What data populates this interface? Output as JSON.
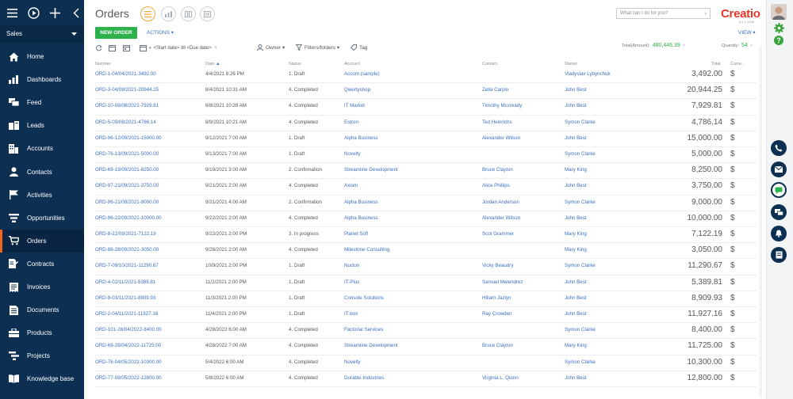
{
  "sidebar": {
    "section": "Sales",
    "items": [
      {
        "label": "Home",
        "icon": "home-icon"
      },
      {
        "label": "Dashboards",
        "icon": "dashboard-icon"
      },
      {
        "label": "Feed",
        "icon": "feed-icon"
      },
      {
        "label": "Leads",
        "icon": "leads-icon"
      },
      {
        "label": "Accounts",
        "icon": "accounts-icon"
      },
      {
        "label": "Contacts",
        "icon": "contacts-icon"
      },
      {
        "label": "Activities",
        "icon": "flag-icon"
      },
      {
        "label": "Opportunities",
        "icon": "funnel-icon"
      },
      {
        "label": "Orders",
        "icon": "cart-icon"
      },
      {
        "label": "Contracts",
        "icon": "contracts-icon"
      },
      {
        "label": "Invoices",
        "icon": "invoices-icon"
      },
      {
        "label": "Documents",
        "icon": "documents-icon"
      },
      {
        "label": "Products",
        "icon": "products-icon"
      },
      {
        "label": "Projects",
        "icon": "projects-icon"
      },
      {
        "label": "Knowledge base",
        "icon": "book-icon"
      }
    ]
  },
  "page": {
    "title": "Orders",
    "search_placeholder": "What can I do for you?",
    "logo": "Creatio",
    "logo_version": "8.1.1.2908",
    "new_order_label": "NEW ORDER",
    "actions_label": "ACTIONS ▾",
    "view_label": "VIEW ▾"
  },
  "filters": {
    "date_range": "<Start date> till <Due date>",
    "owner": "Owner ▾",
    "filters_folders": "Filters/folders ▾",
    "tag": "Tag",
    "total_amount_label": "Total(Amount):",
    "total_amount_value": "480,446.39",
    "quantity_label": "Quantity:",
    "quantity_value": "54"
  },
  "table": {
    "headers": {
      "number": "Number",
      "date": "Date",
      "status": "Status",
      "account": "Account",
      "contact": "Contact",
      "owner": "Owner",
      "total": "Total",
      "currency": "Curre..."
    },
    "rows": [
      {
        "number": "ORD-1-04/04/2021-3492.00",
        "date": "4/4/2021 8:26 PM",
        "status": "1. Draft",
        "account": "Accom (sample)",
        "contact": "",
        "owner": "Vladyslav Lybynchuk",
        "total": "3,492.00",
        "currency": "$"
      },
      {
        "number": "ORD-3-04/08/2021-20944.25",
        "date": "8/4/2021 10:31 AM",
        "status": "4. Completed",
        "account": "Qwertyshop",
        "contact": "Zella Carpio",
        "owner": "John Best",
        "total": "20,944.25",
        "currency": "$"
      },
      {
        "number": "ORD-10-08/08/2021-7929.81",
        "date": "8/8/2021 10:28 AM",
        "status": "4. Completed",
        "account": "IT Market",
        "contact": "Timothy Mccready",
        "owner": "John Best",
        "total": "7,929.81",
        "currency": "$"
      },
      {
        "number": "ORD-5-09/08/2021-4786.14",
        "date": "8/9/2021 10:21 AM",
        "status": "4. Completed",
        "account": "Estron",
        "contact": "Ted Heinrichs",
        "owner": "Symon Clarke",
        "total": "4,786.14",
        "currency": "$"
      },
      {
        "number": "ORD-96-12/09/2021-15000.00",
        "date": "9/12/2021 7:00 AM",
        "status": "1. Draft",
        "account": "Alpha Business",
        "contact": "Alexander Wilson",
        "owner": "John Best",
        "total": "15,000.00",
        "currency": "$"
      },
      {
        "number": "ORD-76-13/09/2021-5000.00",
        "date": "9/13/2021 7:00 AM",
        "status": "1. Draft",
        "account": "Novelty",
        "contact": "",
        "owner": "Symon Clarke",
        "total": "5,000.00",
        "currency": "$"
      },
      {
        "number": "ORD-69-19/09/2021-8250.00",
        "date": "9/19/2021 3:00 AM",
        "status": "2. Confirmation",
        "account": "Streamline Development",
        "contact": "Bruce Clayton",
        "owner": "Mary King",
        "total": "8,250.00",
        "currency": "$"
      },
      {
        "number": "ORD-97-21/09/2021-3750.00",
        "date": "9/21/2021 2:00 AM",
        "status": "4. Completed",
        "account": "Axiom",
        "contact": "Alice Phillips",
        "owner": "John Best",
        "total": "3,750.00",
        "currency": "$"
      },
      {
        "number": "ORD-96-21/09/2021-9000.00",
        "date": "9/21/2021 4:00 AM",
        "status": "2. Confirmation",
        "account": "Alpha Business",
        "contact": "Jordan Anderson",
        "owner": "Symon Clarke",
        "total": "9,000.00",
        "currency": "$"
      },
      {
        "number": "ORD-96-22/09/2021-10000.00",
        "date": "9/22/2021 2:00 AM",
        "status": "4. Completed",
        "account": "Alpha Business",
        "contact": "Alexander Wilson",
        "owner": "John Best",
        "total": "10,000.00",
        "currency": "$"
      },
      {
        "number": "ORD-8-22/09/2021-7122.19",
        "date": "9/22/2021 2:00 PM",
        "status": "3. In progress",
        "account": "Planet Soft",
        "contact": "Scot Grammer",
        "owner": "Mary King",
        "total": "7,122.19",
        "currency": "$"
      },
      {
        "number": "ORD-88-28/09/2021-3050.00",
        "date": "9/28/2021 2:00 AM",
        "status": "4. Completed",
        "account": "Milestone Consulting",
        "contact": "",
        "owner": "Mary King",
        "total": "3,050.00",
        "currency": "$"
      },
      {
        "number": "ORD-7-09/10/2021-11290.67",
        "date": "10/9/2021 2:00 PM",
        "status": "1. Draft",
        "account": "Nuclon",
        "contact": "Vicky Beaudry",
        "owner": "Symon Clarke",
        "total": "11,290.67",
        "currency": "$"
      },
      {
        "number": "ORD-4-02/11/2021-5389.81",
        "date": "11/2/2021 2:00 PM",
        "status": "1. Draft",
        "account": "IT-Plus",
        "contact": "Samuel Melendrez",
        "owner": "John Best",
        "total": "5,389.81",
        "currency": "$"
      },
      {
        "number": "ORD-9-03/11/2021-8909.93",
        "date": "11/3/2021 2:00 PM",
        "status": "1. Draft",
        "account": "Console Solutions",
        "contact": "Hiliam Jazlyn",
        "owner": "John Best",
        "total": "8,909.93",
        "currency": "$"
      },
      {
        "number": "ORD-2-04/11/2021-11927.16",
        "date": "11/4/2021 2:00 PM",
        "status": "1. Draft",
        "account": "IT-box",
        "contact": "Ray Crowden",
        "owner": "John Best",
        "total": "11,927.16",
        "currency": "$"
      },
      {
        "number": "ORD-101-28/04/2022-8400.00",
        "date": "4/28/2022 6:00 AM",
        "status": "4. Completed",
        "account": "Factorial Services",
        "contact": "",
        "owner": "Symon Clarke",
        "total": "8,400.00",
        "currency": "$"
      },
      {
        "number": "ORD-69-28/04/2022-11725.00",
        "date": "4/28/2022 7:00 AM",
        "status": "4. Completed",
        "account": "Streamline Development",
        "contact": "Bruce Clayton",
        "owner": "Mary King",
        "total": "11,725.00",
        "currency": "$"
      },
      {
        "number": "ORD-76-04/05/2022-10300.00",
        "date": "5/4/2022 6:00 AM",
        "status": "4. Completed",
        "account": "Novelty",
        "contact": "",
        "owner": "Symon Clarke",
        "total": "10,300.00",
        "currency": "$"
      },
      {
        "number": "ORD-77-08/05/2022-12800.00",
        "date": "5/8/2022 6:00 AM",
        "status": "4. Completed",
        "account": "Durable Industries",
        "contact": "Virginia L. Quinn",
        "owner": "John Best",
        "total": "12,800.00",
        "currency": "$"
      }
    ]
  },
  "colors": {
    "sidebar": "#0c2f52",
    "accent": "#f0651c",
    "link": "#3b6fc1",
    "green": "#2db24b",
    "logo": "#e5362a"
  }
}
